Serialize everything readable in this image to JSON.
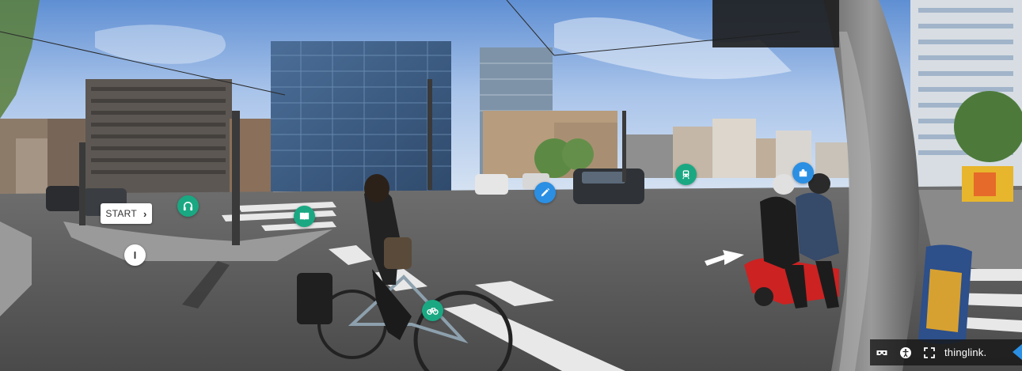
{
  "start_button": {
    "label": "START",
    "chevron": "›"
  },
  "hotspots": [
    {
      "name": "hotspot-headphones",
      "icon": "headphones-icon",
      "color": "#1aa882"
    },
    {
      "name": "hotspot-book",
      "icon": "book-icon",
      "color": "#1aa882"
    },
    {
      "name": "hotspot-pencil",
      "icon": "pencil-icon",
      "color": "#2b8fe3"
    },
    {
      "name": "hotspot-tram",
      "icon": "tram-icon",
      "color": "#1aa882"
    },
    {
      "name": "hotspot-puzzle",
      "icon": "puzzle-icon",
      "color": "#2b8fe3"
    },
    {
      "name": "hotspot-bicycle",
      "icon": "bicycle-icon",
      "color": "#1aa882"
    },
    {
      "name": "hotspot-info",
      "icon": "info-icon",
      "color": "#ffffff"
    }
  ],
  "toolbar": {
    "buttons": [
      {
        "name": "vr-mode-button",
        "icon": "vr-headset-icon"
      },
      {
        "name": "accessibility-button",
        "icon": "accessibility-icon"
      },
      {
        "name": "fullscreen-button",
        "icon": "fullscreen-icon"
      }
    ],
    "brand": "thinglink."
  }
}
